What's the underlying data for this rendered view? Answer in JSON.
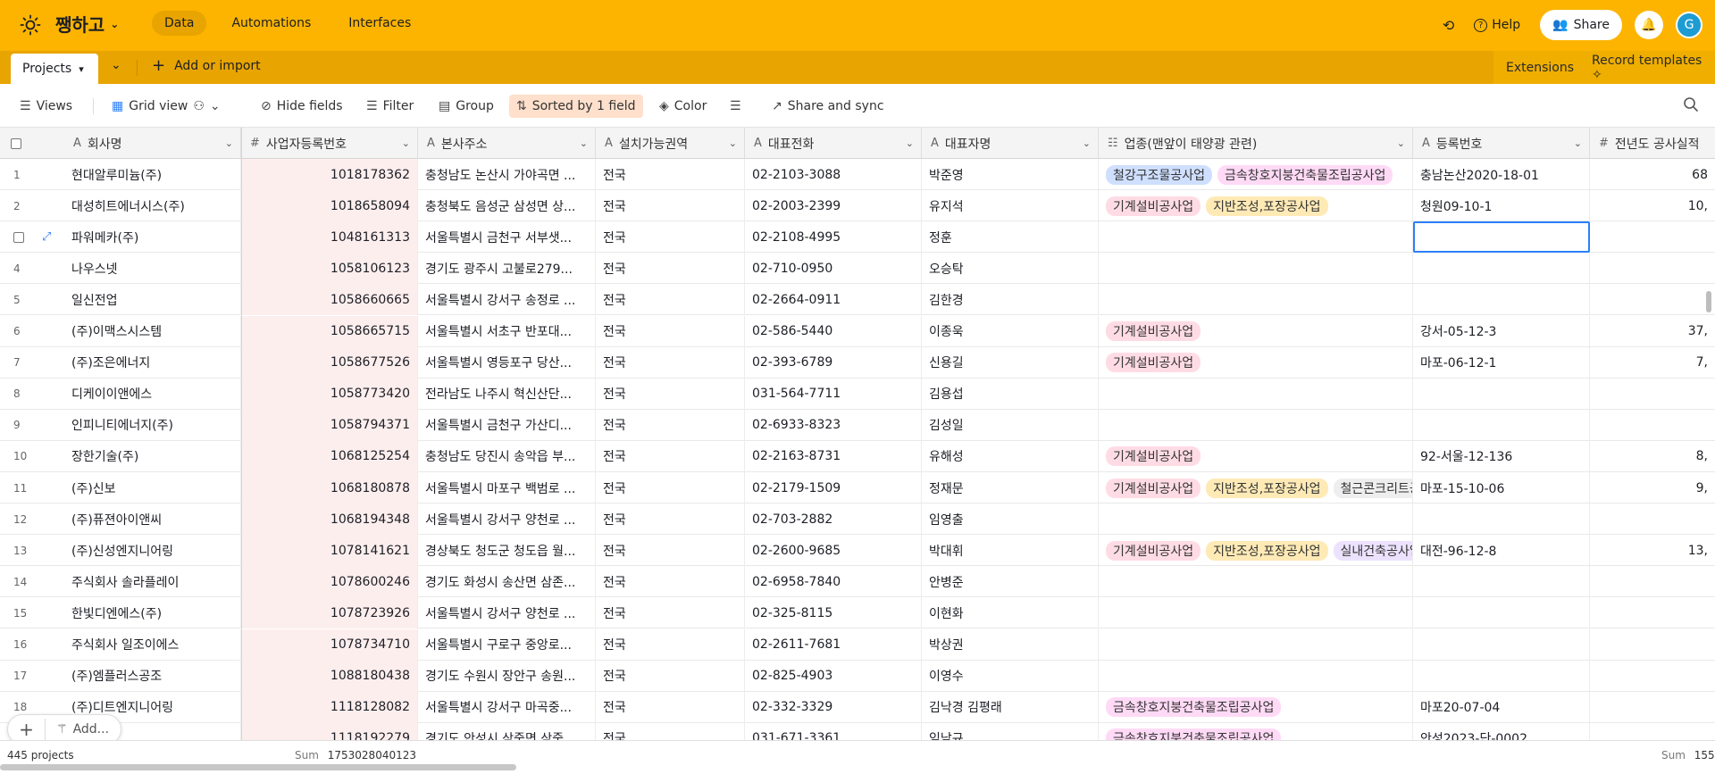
{
  "app": {
    "base_name": "쨍하고",
    "nav": [
      "Data",
      "Automations",
      "Interfaces"
    ],
    "help_label": "Help",
    "share_label": "Share",
    "avatar_initial": "G",
    "accent_color": "#fcb400"
  },
  "tabs": {
    "active_table": "Projects",
    "add_import_label": "Add or import",
    "extensions_label": "Extensions",
    "record_templates_label": "Record templates"
  },
  "viewbar": {
    "views_label": "Views",
    "grid_view_label": "Grid view",
    "hide_fields_label": "Hide fields",
    "filter_label": "Filter",
    "group_label": "Group",
    "sorted_label": "Sorted by 1 field",
    "color_label": "Color",
    "share_sync_label": "Share and sync"
  },
  "columns": [
    {
      "name": "회사명",
      "type_icon": "A"
    },
    {
      "name": "사업자등록번호",
      "type_icon": "#"
    },
    {
      "name": "본사주소",
      "type_icon": "A"
    },
    {
      "name": "설치가능권역",
      "type_icon": "A"
    },
    {
      "name": "대표전화",
      "type_icon": "A"
    },
    {
      "name": "대표자명",
      "type_icon": "A"
    },
    {
      "name": "업종(맨앞이 태양광 관련)",
      "type_icon": "☷"
    },
    {
      "name": "등록번호",
      "type_icon": "A"
    },
    {
      "name": "전년도 공사실적",
      "type_icon": "#"
    }
  ],
  "tag_colors": {
    "철강구조물공사업": "#cfdfff",
    "금속창호지붕건축물조립공사업": "#ffdaf6",
    "기계설비공사업": "#ffdce5",
    "지반조성,포장공사업": "#ffeab6",
    "철근콘크리트공사업": "#eeeeee",
    "실내건축공사업": "#ede2fe"
  },
  "rows": [
    {
      "n": "1",
      "company": "현대알루미늄(주)",
      "bizno": "1018178362",
      "address": "충청남도 논산시 가야곡면 ...",
      "region": "전국",
      "phone": "02-2103-3088",
      "ceo": "박준영",
      "tags": [
        "철강구조물공사업",
        "금속창호지붕건축물조립공사업"
      ],
      "regno": "충남논산2020-18-01",
      "perf": "68"
    },
    {
      "n": "2",
      "company": "대성히트에너시스(주)",
      "bizno": "1018658094",
      "address": "충청북도 음성군 삼성면 상...",
      "region": "전국",
      "phone": "02-2003-2399",
      "ceo": "유지석",
      "tags": [
        "기계설비공사업",
        "지반조성,포장공사업"
      ],
      "regno": "청원09-10-1",
      "perf": "10,"
    },
    {
      "n": "",
      "company": "파워메카(주)",
      "bizno": "1048161313",
      "address": "서울특별시 금천구 서부샛...",
      "region": "전국",
      "phone": "02-2108-4995",
      "ceo": "정훈",
      "tags": [],
      "regno": "",
      "perf": ""
    },
    {
      "n": "4",
      "company": "나우스넷",
      "bizno": "1058106123",
      "address": "경기도 광주시 고불로279...",
      "region": "전국",
      "phone": "02-710-0950",
      "ceo": "오승탁",
      "tags": [],
      "regno": "",
      "perf": ""
    },
    {
      "n": "5",
      "company": "일신전업",
      "bizno": "1058660665",
      "address": "서울특별시 강서구 송정로 ...",
      "region": "전국",
      "phone": "02-2664-0911",
      "ceo": "김한경",
      "tags": [],
      "regno": "",
      "perf": ""
    },
    {
      "n": "6",
      "company": "(주)이맥스시스템",
      "bizno": "1058665715",
      "address": "서울특별시 서초구 반포대...",
      "region": "전국",
      "phone": "02-586-5440",
      "ceo": "이종욱",
      "tags": [
        "기계설비공사업"
      ],
      "regno": "강서-05-12-3",
      "perf": "37,"
    },
    {
      "n": "7",
      "company": "(주)조은에너지",
      "bizno": "1058677526",
      "address": "서울특별시 영등포구 당산...",
      "region": "전국",
      "phone": "02-393-6789",
      "ceo": "신용길",
      "tags": [
        "기계설비공사업"
      ],
      "regno": "마포-06-12-1",
      "perf": "7,"
    },
    {
      "n": "8",
      "company": "디케이이앤에스",
      "bizno": "1058773420",
      "address": "전라남도 나주시 혁신산단...",
      "region": "전국",
      "phone": "031-564-7711",
      "ceo": "김용섭",
      "tags": [],
      "regno": "",
      "perf": ""
    },
    {
      "n": "9",
      "company": "인피니티에너지(주)",
      "bizno": "1058794371",
      "address": "서울특별시 금천구 가산디...",
      "region": "전국",
      "phone": "02-6933-8323",
      "ceo": "김성일",
      "tags": [],
      "regno": "",
      "perf": ""
    },
    {
      "n": "10",
      "company": "장한기술(주)",
      "bizno": "1068125254",
      "address": "충청남도 당진시 송악읍 부...",
      "region": "전국",
      "phone": "02-2163-8731",
      "ceo": "유해성",
      "tags": [
        "기계설비공사업"
      ],
      "regno": "92-서울-12-136",
      "perf": "8,"
    },
    {
      "n": "11",
      "company": "(주)신보",
      "bizno": "1068180878",
      "address": "서울특별시 마포구 백범로 ...",
      "region": "전국",
      "phone": "02-2179-1509",
      "ceo": "정재문",
      "tags": [
        "기계설비공사업",
        "지반조성,포장공사업",
        "철근콘크리트공사업"
      ],
      "regno": "마포-15-10-06",
      "perf": "9,"
    },
    {
      "n": "12",
      "company": "(주)퓨젼아이앤씨",
      "bizno": "1068194348",
      "address": "서울특별시 강서구 양천로 ...",
      "region": "전국",
      "phone": "02-703-2882",
      "ceo": "임영출",
      "tags": [],
      "regno": "",
      "perf": ""
    },
    {
      "n": "13",
      "company": "(주)신성엔지니어링",
      "bizno": "1078141621",
      "address": "경상북도 청도군 청도읍 월...",
      "region": "전국",
      "phone": "02-2600-9685",
      "ceo": "박대휘",
      "tags": [
        "기계설비공사업",
        "지반조성,포장공사업",
        "실내건축공사업"
      ],
      "regno": "대전-96-12-8",
      "perf": "13,"
    },
    {
      "n": "14",
      "company": "주식회사 솔라플레이",
      "bizno": "1078600246",
      "address": "경기도 화성시 송산면 삼존...",
      "region": "전국",
      "phone": "02-6958-7840",
      "ceo": "안병준",
      "tags": [],
      "regno": "",
      "perf": ""
    },
    {
      "n": "15",
      "company": "한빛디엔에스(주)",
      "bizno": "1078723926",
      "address": "서울특별시 강서구 양천로 ...",
      "region": "전국",
      "phone": "02-325-8115",
      "ceo": "이현화",
      "tags": [],
      "regno": "",
      "perf": ""
    },
    {
      "n": "16",
      "company": "주식회사 일조이에스",
      "bizno": "1078734710",
      "address": "서울특별시 구로구 중앙로...",
      "region": "전국",
      "phone": "02-2611-7681",
      "ceo": "박상권",
      "tags": [],
      "regno": "",
      "perf": ""
    },
    {
      "n": "17",
      "company": "(주)엠플러스공조",
      "bizno": "1088180438",
      "address": "경기도 수원시 장안구 송원...",
      "region": "전국",
      "phone": "02-825-4903",
      "ceo": "이영수",
      "tags": [],
      "regno": "",
      "perf": ""
    },
    {
      "n": "18",
      "company": "(주)디트엔지니어링",
      "bizno": "1118128082",
      "address": "서울특별시 강서구 마곡중...",
      "region": "전국",
      "phone": "02-332-3329",
      "ceo": "김낙경 김평래",
      "tags": [
        "금속창호지붕건축물조립공사업"
      ],
      "regno": "마포20-07-04",
      "perf": ""
    },
    {
      "n": "",
      "company": "",
      "bizno": "1118192279",
      "address": "경기도 안성시 삼죽면 삼죽...",
      "region": "전국",
      "phone": "031-671-3361",
      "ceo": "임남규",
      "tags": [
        "금속창호지붕건축물조립공사업"
      ],
      "regno": "안성2023-단-0002",
      "perf": ""
    }
  ],
  "footer": {
    "count_label": "445 projects",
    "sum_label": "Sum",
    "sum_bizno": "1753028040123",
    "sum_perf": "155,"
  },
  "add_pill_label": "Add..."
}
